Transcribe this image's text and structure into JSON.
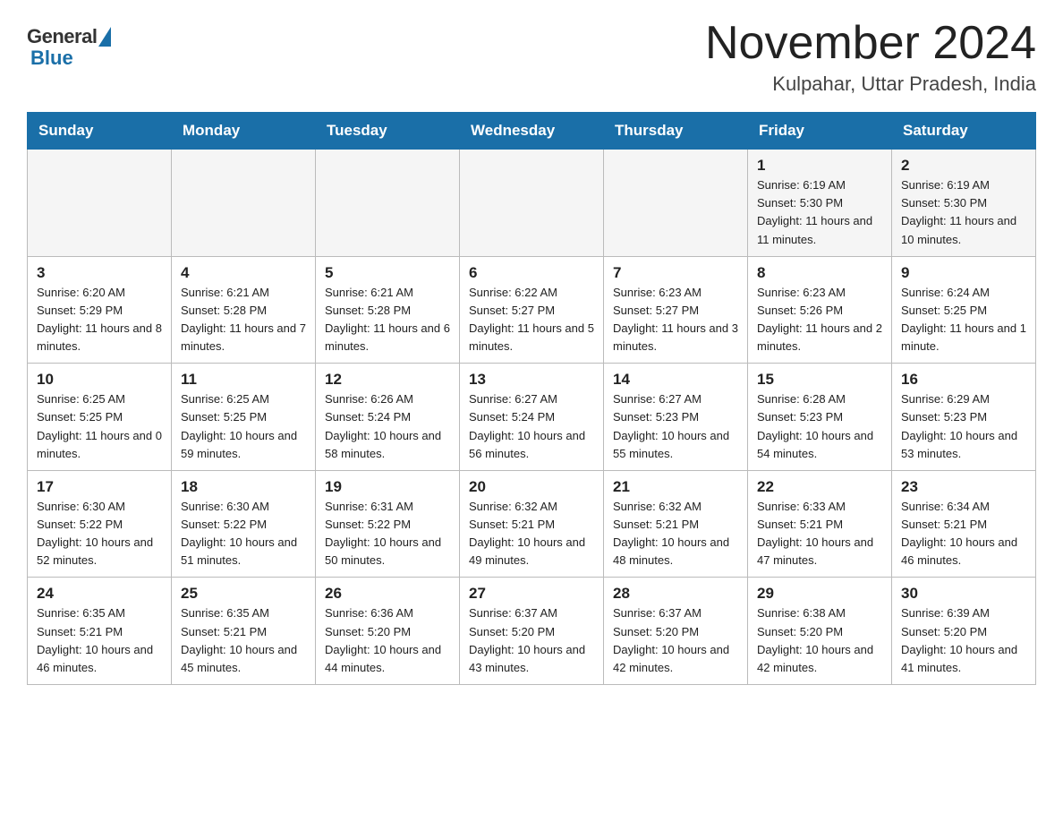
{
  "header": {
    "logo_general": "General",
    "logo_blue": "Blue",
    "month_year": "November 2024",
    "location": "Kulpahar, Uttar Pradesh, India"
  },
  "days_of_week": [
    "Sunday",
    "Monday",
    "Tuesday",
    "Wednesday",
    "Thursday",
    "Friday",
    "Saturday"
  ],
  "weeks": [
    {
      "days": [
        {
          "number": "",
          "info": ""
        },
        {
          "number": "",
          "info": ""
        },
        {
          "number": "",
          "info": ""
        },
        {
          "number": "",
          "info": ""
        },
        {
          "number": "",
          "info": ""
        },
        {
          "number": "1",
          "info": "Sunrise: 6:19 AM\nSunset: 5:30 PM\nDaylight: 11 hours and 11 minutes."
        },
        {
          "number": "2",
          "info": "Sunrise: 6:19 AM\nSunset: 5:30 PM\nDaylight: 11 hours and 10 minutes."
        }
      ]
    },
    {
      "days": [
        {
          "number": "3",
          "info": "Sunrise: 6:20 AM\nSunset: 5:29 PM\nDaylight: 11 hours and 8 minutes."
        },
        {
          "number": "4",
          "info": "Sunrise: 6:21 AM\nSunset: 5:28 PM\nDaylight: 11 hours and 7 minutes."
        },
        {
          "number": "5",
          "info": "Sunrise: 6:21 AM\nSunset: 5:28 PM\nDaylight: 11 hours and 6 minutes."
        },
        {
          "number": "6",
          "info": "Sunrise: 6:22 AM\nSunset: 5:27 PM\nDaylight: 11 hours and 5 minutes."
        },
        {
          "number": "7",
          "info": "Sunrise: 6:23 AM\nSunset: 5:27 PM\nDaylight: 11 hours and 3 minutes."
        },
        {
          "number": "8",
          "info": "Sunrise: 6:23 AM\nSunset: 5:26 PM\nDaylight: 11 hours and 2 minutes."
        },
        {
          "number": "9",
          "info": "Sunrise: 6:24 AM\nSunset: 5:25 PM\nDaylight: 11 hours and 1 minute."
        }
      ]
    },
    {
      "days": [
        {
          "number": "10",
          "info": "Sunrise: 6:25 AM\nSunset: 5:25 PM\nDaylight: 11 hours and 0 minutes."
        },
        {
          "number": "11",
          "info": "Sunrise: 6:25 AM\nSunset: 5:25 PM\nDaylight: 10 hours and 59 minutes."
        },
        {
          "number": "12",
          "info": "Sunrise: 6:26 AM\nSunset: 5:24 PM\nDaylight: 10 hours and 58 minutes."
        },
        {
          "number": "13",
          "info": "Sunrise: 6:27 AM\nSunset: 5:24 PM\nDaylight: 10 hours and 56 minutes."
        },
        {
          "number": "14",
          "info": "Sunrise: 6:27 AM\nSunset: 5:23 PM\nDaylight: 10 hours and 55 minutes."
        },
        {
          "number": "15",
          "info": "Sunrise: 6:28 AM\nSunset: 5:23 PM\nDaylight: 10 hours and 54 minutes."
        },
        {
          "number": "16",
          "info": "Sunrise: 6:29 AM\nSunset: 5:23 PM\nDaylight: 10 hours and 53 minutes."
        }
      ]
    },
    {
      "days": [
        {
          "number": "17",
          "info": "Sunrise: 6:30 AM\nSunset: 5:22 PM\nDaylight: 10 hours and 52 minutes."
        },
        {
          "number": "18",
          "info": "Sunrise: 6:30 AM\nSunset: 5:22 PM\nDaylight: 10 hours and 51 minutes."
        },
        {
          "number": "19",
          "info": "Sunrise: 6:31 AM\nSunset: 5:22 PM\nDaylight: 10 hours and 50 minutes."
        },
        {
          "number": "20",
          "info": "Sunrise: 6:32 AM\nSunset: 5:21 PM\nDaylight: 10 hours and 49 minutes."
        },
        {
          "number": "21",
          "info": "Sunrise: 6:32 AM\nSunset: 5:21 PM\nDaylight: 10 hours and 48 minutes."
        },
        {
          "number": "22",
          "info": "Sunrise: 6:33 AM\nSunset: 5:21 PM\nDaylight: 10 hours and 47 minutes."
        },
        {
          "number": "23",
          "info": "Sunrise: 6:34 AM\nSunset: 5:21 PM\nDaylight: 10 hours and 46 minutes."
        }
      ]
    },
    {
      "days": [
        {
          "number": "24",
          "info": "Sunrise: 6:35 AM\nSunset: 5:21 PM\nDaylight: 10 hours and 46 minutes."
        },
        {
          "number": "25",
          "info": "Sunrise: 6:35 AM\nSunset: 5:21 PM\nDaylight: 10 hours and 45 minutes."
        },
        {
          "number": "26",
          "info": "Sunrise: 6:36 AM\nSunset: 5:20 PM\nDaylight: 10 hours and 44 minutes."
        },
        {
          "number": "27",
          "info": "Sunrise: 6:37 AM\nSunset: 5:20 PM\nDaylight: 10 hours and 43 minutes."
        },
        {
          "number": "28",
          "info": "Sunrise: 6:37 AM\nSunset: 5:20 PM\nDaylight: 10 hours and 42 minutes."
        },
        {
          "number": "29",
          "info": "Sunrise: 6:38 AM\nSunset: 5:20 PM\nDaylight: 10 hours and 42 minutes."
        },
        {
          "number": "30",
          "info": "Sunrise: 6:39 AM\nSunset: 5:20 PM\nDaylight: 10 hours and 41 minutes."
        }
      ]
    }
  ]
}
